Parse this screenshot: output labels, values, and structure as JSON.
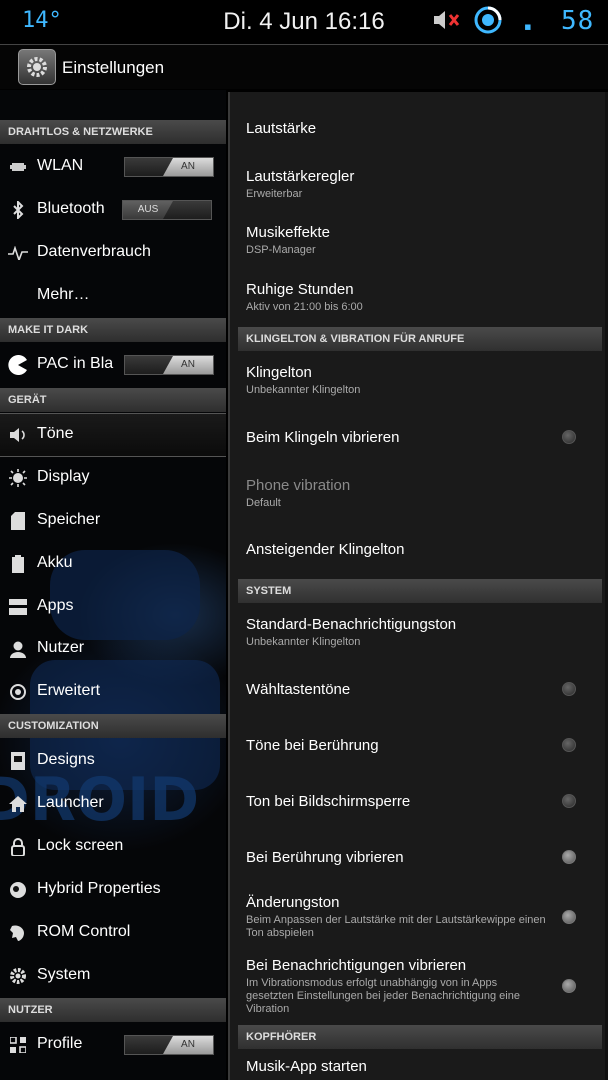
{
  "status_bar": {
    "temperature": "14°",
    "clock": "Di. 4 Jun 16:16",
    "battery": "58",
    "accent_color": "#3fb8ff"
  },
  "app_bar": {
    "title": "Einstellungen",
    "icon": "settings-gear-icon"
  },
  "sidebar": {
    "categories": [
      "DRAHTLOS & NETZWERKE",
      "MAKE IT DARK",
      "GERÄT",
      "CUSTOMIZATION",
      "NUTZER"
    ],
    "items": [
      {
        "label": "WLAN",
        "icon": "wifi-icon",
        "toggle": "AN"
      },
      {
        "label": "Bluetooth",
        "icon": "bluetooth-icon",
        "toggle": "AUS"
      },
      {
        "label": "Datenverbrauch",
        "icon": "data-usage-icon"
      },
      {
        "label": "Mehr…",
        "icon": ""
      },
      {
        "label": "PAC in Bla",
        "icon": "pacman-icon",
        "toggle": "AN"
      },
      {
        "label": "Töne",
        "icon": "speaker-icon",
        "selected": true
      },
      {
        "label": "Display",
        "icon": "display-icon"
      },
      {
        "label": "Speicher",
        "icon": "storage-icon"
      },
      {
        "label": "Akku",
        "icon": "battery-icon"
      },
      {
        "label": "Apps",
        "icon": "apps-icon"
      },
      {
        "label": "Nutzer",
        "icon": "user-icon"
      },
      {
        "label": "Erweitert",
        "icon": "advanced-icon"
      },
      {
        "label": "Designs",
        "icon": "themes-icon"
      },
      {
        "label": "Launcher",
        "icon": "home-icon"
      },
      {
        "label": "Lock screen",
        "icon": "lock-icon"
      },
      {
        "label": "Hybrid Properties",
        "icon": "hybrid-icon"
      },
      {
        "label": "ROM Control",
        "icon": "rom-control-icon"
      },
      {
        "label": "System",
        "icon": "system-gear-icon"
      },
      {
        "label": "Profile",
        "icon": "profile-icon",
        "toggle": "AN"
      }
    ]
  },
  "content": {
    "categories": [
      "KLINGELTON & VIBRATION FÜR ANRUFE",
      "SYSTEM",
      "KOPFHÖRER"
    ],
    "items": [
      {
        "title": "Lautstärke"
      },
      {
        "title": "Lautstärkeregler",
        "summary": "Erweiterbar"
      },
      {
        "title": "Musikeffekte",
        "summary": "DSP-Manager"
      },
      {
        "title": "Ruhige Stunden",
        "summary": "Aktiv von 21:00 bis 6:00"
      },
      {
        "title": "Klingelton",
        "summary": "Unbekannter Klingelton"
      },
      {
        "title": "Beim Klingeln vibrieren",
        "checked": false
      },
      {
        "title": "Phone vibration",
        "summary": "Default",
        "disabled": true
      },
      {
        "title": "Ansteigender Klingelton"
      },
      {
        "title": "Standard-Benachrichtigungston",
        "summary": "Unbekannter Klingelton"
      },
      {
        "title": "Wähltastentöne",
        "checked": false
      },
      {
        "title": "Töne bei Berührung",
        "checked": false
      },
      {
        "title": "Ton bei Bildschirmsperre",
        "checked": false
      },
      {
        "title": "Bei Berührung vibrieren",
        "checked": false
      },
      {
        "title": "Änderungston",
        "summary": "Beim Anpassen der Lautstärke mit der Lautstärkewippe einen Ton abspielen",
        "checked": false
      },
      {
        "title": "Bei Benachrichtigungen vibrieren",
        "summary": "Im Vibrationsmodus erfolgt unabhängig von in Apps gesetzten Einstellungen bei jeder Benachrichtigung eine Vibration",
        "checked": false
      },
      {
        "title": "Musik-App starten"
      }
    ]
  }
}
